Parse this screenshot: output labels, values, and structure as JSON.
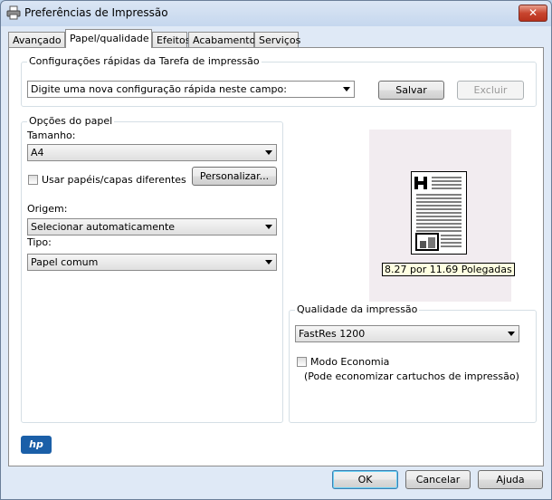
{
  "window": {
    "title": "Preferências de Impressão",
    "close_label": "✕"
  },
  "tabs": [
    "Avançado",
    "Papel/qualidade",
    "Efeitos",
    "Acabamento",
    "Serviços"
  ],
  "quick_settings": {
    "group_label": "Configurações rápidas da Tarefa de impressão",
    "combo_value": "Digite uma nova configuração rápida neste campo:",
    "save_label": "Salvar",
    "delete_label": "Excluir"
  },
  "paper_options": {
    "group_label": "Opções do papel",
    "size_label": "Tamanho:",
    "size_value": "A4",
    "custom_paper_label": "Usar papéis/capas diferentes",
    "customize_label": "Personalizar...",
    "source_label": "Origem:",
    "source_value": "Selecionar automaticamente",
    "type_label": "Tipo:",
    "type_value": "Papel comum"
  },
  "preview": {
    "dimensions": "8.27 por 11.69 Polegadas"
  },
  "print_quality": {
    "group_label": "Qualidade da impressão",
    "value": "FastRes 1200",
    "economode_label": "Modo Economia",
    "economode_note": "(Pode economizar cartuchos de impressão)"
  },
  "footer": {
    "logo_text": "hp",
    "ok_label": "OK",
    "cancel_label": "Cancelar",
    "help_label": "Ajuda"
  }
}
